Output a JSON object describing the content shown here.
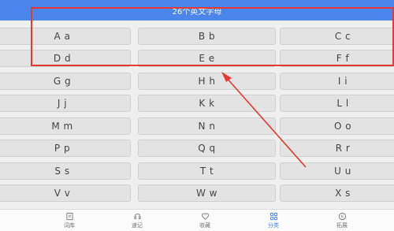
{
  "header": {
    "title": "26个英文字母"
  },
  "letters": [
    [
      "A a",
      "B b",
      "C c"
    ],
    [
      "D d",
      "E e",
      "F f"
    ],
    [
      "G g",
      "H h",
      "I i"
    ],
    [
      "J j",
      "K k",
      "L l"
    ],
    [
      "M m",
      "N n",
      "O o"
    ],
    [
      "P p",
      "Q q",
      "R r"
    ],
    [
      "S s",
      "T t",
      "U u"
    ],
    [
      "V v",
      "W w",
      "X s"
    ]
  ],
  "nav": {
    "items": [
      {
        "label": "词库",
        "icon": "book-icon"
      },
      {
        "label": "速记",
        "icon": "headset-icon"
      },
      {
        "label": "收藏",
        "icon": "heart-icon"
      },
      {
        "label": "分类",
        "icon": "grid-icon"
      },
      {
        "label": "拓展",
        "icon": "expand-icon"
      }
    ],
    "active_index": 3
  },
  "colors": {
    "header": "#4a86ec",
    "accent": "#3f7fe9",
    "annotation": "#e53935"
  }
}
